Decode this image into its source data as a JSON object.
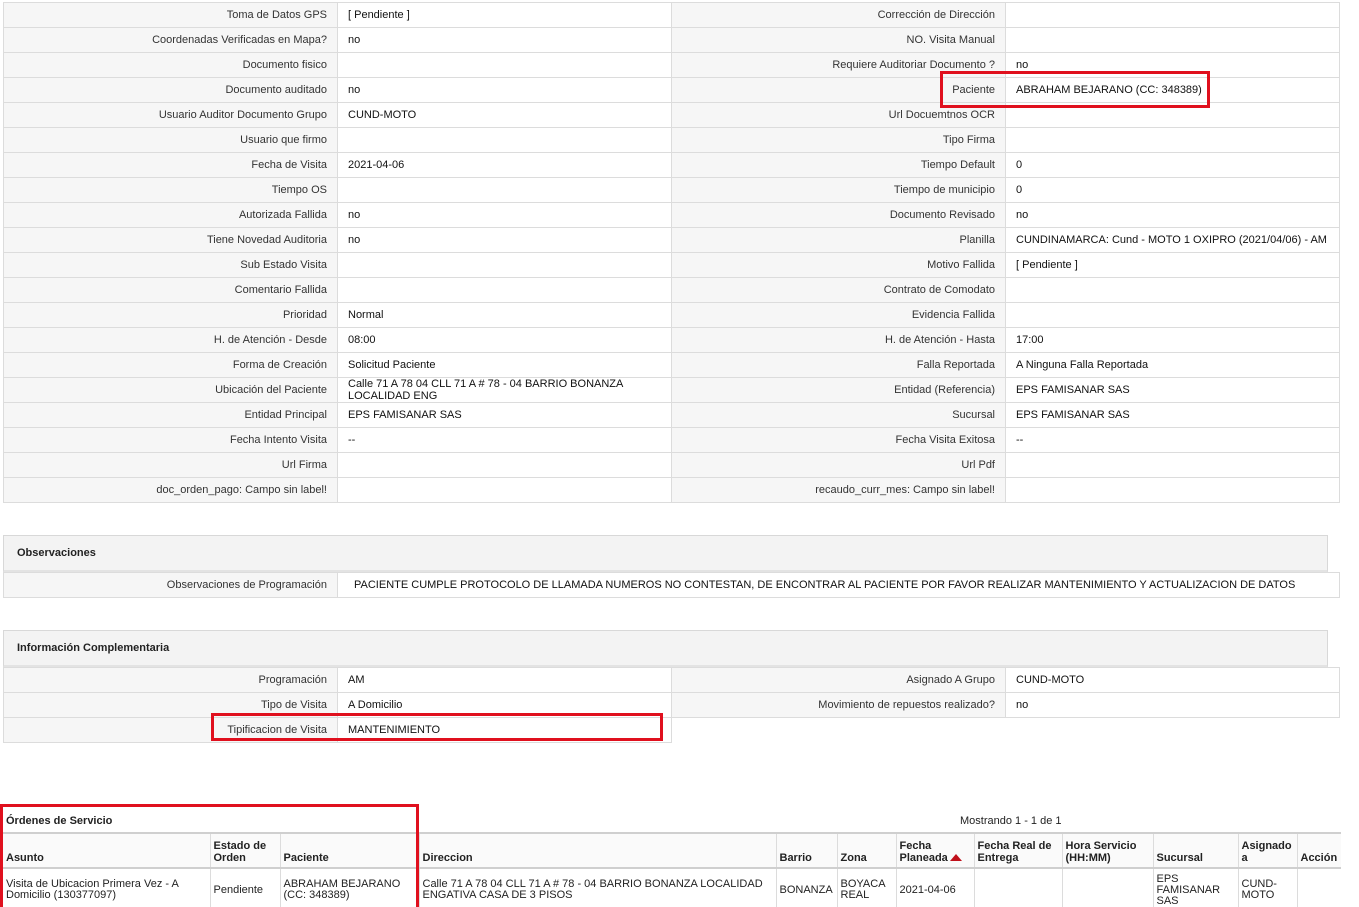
{
  "detail_rows": [
    {
      "l1": "Toma de Datos GPS",
      "v1": "[ Pendiente ]",
      "l2": "Corrección de Dirección",
      "v2": ""
    },
    {
      "l1": "Coordenadas Verificadas en Mapa?",
      "v1": " no",
      "l2": "NO. Visita Manual",
      "v2": ""
    },
    {
      "l1": "Documento fisico",
      "v1": "",
      "l2": "Requiere Auditoriar Documento ?",
      "v2": " no"
    },
    {
      "l1": "Documento auditado",
      "v1": " no",
      "l2": "Paciente",
      "v2": "ABRAHAM BEJARANO (CC: 348389)"
    },
    {
      "l1": "Usuario Auditor Documento Grupo",
      "v1": "CUND-MOTO",
      "l2": "Url Docuemtnos OCR",
      "v2": ""
    },
    {
      "l1": "Usuario que firmo",
      "v1": "",
      "l2": "Tipo Firma",
      "v2": ""
    },
    {
      "l1": "Fecha de Visita",
      "v1": " 2021-04-06",
      "l2": "Tiempo Default",
      "v2": "0"
    },
    {
      "l1": "Tiempo OS",
      "v1": "",
      "l2": "Tiempo de municipio",
      "v2": "0"
    },
    {
      "l1": "Autorizada Fallida",
      "v1": " no",
      "l2": "Documento Revisado",
      "v2": " no"
    },
    {
      "l1": "Tiene Novedad Auditoria",
      "v1": " no",
      "l2": "Planilla",
      "v2": "CUNDINAMARCA: Cund - MOTO 1 OXIPRO (2021/04/06) - AM"
    },
    {
      "l1": "Sub Estado Visita",
      "v1": "",
      "l2": "Motivo Fallida",
      "v2": "[ Pendiente ]"
    },
    {
      "l1": "Comentario Fallida",
      "v1": "",
      "l2": "Contrato de Comodato",
      "v2": ""
    },
    {
      "l1": "Prioridad",
      "v1": "Normal",
      "l2": "Evidencia Fallida",
      "v2": ""
    },
    {
      "l1": "H. de Atención - Desde",
      "v1": "08:00",
      "l2": "H. de Atención - Hasta",
      "v2": "17:00"
    },
    {
      "l1": "Forma de Creación",
      "v1": "Solicitud Paciente",
      "l2": "Falla Reportada",
      "v2": "A Ninguna Falla Reportada"
    },
    {
      "l1": "Ubicación del Paciente",
      "v1": "Calle 71 A 78 04 CLL 71 A # 78 - 04 BARRIO BONANZA LOCALIDAD ENG",
      "l2": "Entidad (Referencia)",
      "v2": "EPS FAMISANAR SAS"
    },
    {
      "l1": "Entidad Principal",
      "v1": "EPS FAMISANAR SAS",
      "l2": "Sucursal",
      "v2": "EPS FAMISANAR SAS"
    },
    {
      "l1": "Fecha Intento Visita",
      "v1": " --",
      "l2": "Fecha Visita Exitosa",
      "v2": " --"
    },
    {
      "l1": "Url Firma",
      "v1": "",
      "l2": "Url Pdf",
      "v2": ""
    },
    {
      "l1": "doc_orden_pago: Campo sin label!",
      "v1": "",
      "l2": "recaudo_curr_mes: Campo sin label!",
      "v2": ""
    }
  ],
  "observaciones": {
    "title": "Observaciones",
    "label": "Observaciones de Programación",
    "value": "PACIENTE CUMPLE PROTOCOLO DE LLAMADA NUMEROS NO CONTESTAN, DE ENCONTRAR AL PACIENTE POR FAVOR REALIZAR MANTENIMIENTO Y ACTUALIZACION DE DATOS"
  },
  "info_comp": {
    "title": "Información Complementaria",
    "rows": [
      {
        "l1": "Programación",
        "v1": "AM",
        "l2": "Asignado A Grupo",
        "v2": "CUND-MOTO"
      },
      {
        "l1": "Tipo de Visita",
        "v1": "A Domicilio",
        "l2": "Movimiento de repuestos realizado?",
        "v2": " no"
      }
    ],
    "tipificacion_label": "Tipificacion de Visita",
    "tipificacion_value": "MANTENIMIENTO"
  },
  "orders": {
    "title": "Órdenes de Servicio",
    "count_text": "Mostrando 1 - 1 de 1",
    "headers": {
      "asunto": "Asunto",
      "estado": "Estado de Orden",
      "paciente": "Paciente",
      "direccion": "Direccion",
      "barrio": "Barrio",
      "zona": "Zona",
      "fecha_planeada": "Fecha Planeada",
      "fecha_real": "Fecha Real de Entrega",
      "hora": "Hora Servicio (HH:MM)",
      "sucursal": "Sucursal",
      "asignado": "Asignado a",
      "accion": "Acción"
    },
    "row": {
      "asunto": "Visita de Ubicacion Primera Vez - A Domicilio (130377097)",
      "estado": "Pendiente",
      "paciente": "ABRAHAM BEJARANO (CC: 348389)",
      "direccion": "Calle 71 A 78 04 CLL 71 A # 78 - 04 BARRIO BONANZA LOCALIDAD ENGATIVA CASA DE 3 PISOS",
      "barrio": "BONANZA",
      "zona": "BOYACA REAL",
      "fecha_planeada": "2021-04-06",
      "fecha_real": "",
      "hora": "",
      "sucursal": "EPS FAMISANAR SAS",
      "asignado": "CUND-MOTO",
      "accion": ""
    }
  }
}
